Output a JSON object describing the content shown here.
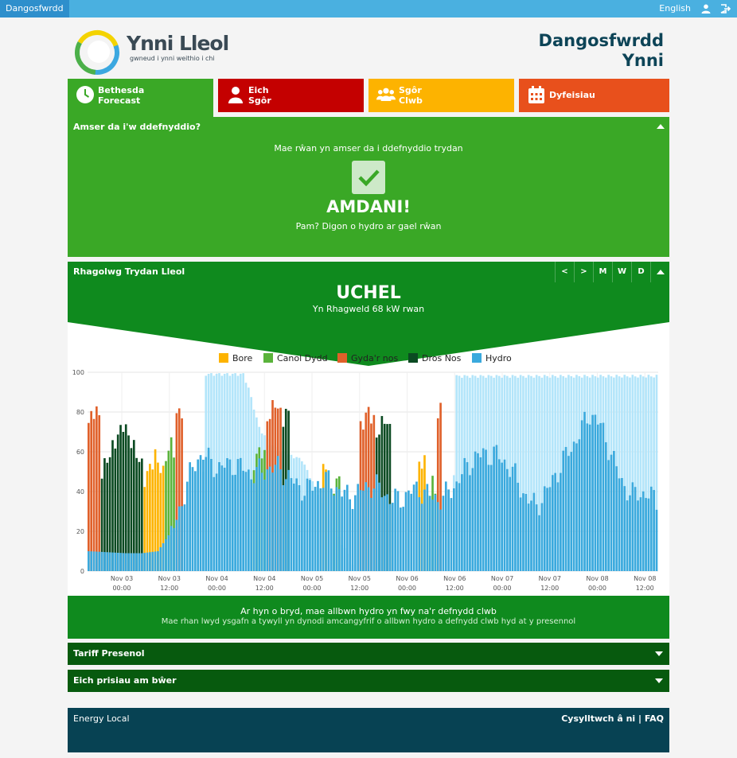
{
  "topbar": {
    "brand": "Dangosfwrdd",
    "language": "English"
  },
  "header": {
    "logo_name": "Ynni Lleol",
    "logo_tagline": "gwneud i ynni weithio i chi",
    "title_line1": "Dangosfwrdd",
    "title_line2": "Ynni"
  },
  "tabs": [
    {
      "label": "Bethesda\nForecast",
      "icon": "clock-icon",
      "color": "#3aa826"
    },
    {
      "label": "Eich\nSgôr",
      "icon": "person-icon",
      "color": "#c40000"
    },
    {
      "label": "Sgôr\nClwb",
      "icon": "group-icon",
      "color": "#fdb300"
    },
    {
      "label": "Dyfeisiau",
      "icon": "calendar-icon",
      "color": "#e8501c"
    }
  ],
  "good_time": {
    "title": "Amser da i'w ddefnyddio?",
    "message": "Mae rŵan yn amser da i ddefnyddio trydan",
    "verdict": "AMDANI!",
    "reason": "Pam? Digon o hydro ar gael rŵan"
  },
  "forecast": {
    "title": "Rhagolwg Trydan Lleol",
    "buttons": [
      "<",
      ">",
      "M",
      "W",
      "D"
    ],
    "level": "UCHEL",
    "subtitle": "Yn Rhagweld 68 kW rwan"
  },
  "chart_data": {
    "type": "bar",
    "ylim": [
      0,
      100
    ],
    "yticks": [
      0,
      20,
      40,
      60,
      80,
      100
    ],
    "grid": true,
    "legend_position": "top",
    "xticks": [
      "Nov 03\n00:00",
      "Nov 03\n12:00",
      "Nov 04\n00:00",
      "Nov 04\n12:00",
      "Nov 05\n00:00",
      "Nov 05\n12:00",
      "Nov 06\n00:00",
      "Nov 06\n12:00",
      "Nov 07\n00:00",
      "Nov 07\n12:00",
      "Nov 08\n00:00",
      "Nov 08\n12:00"
    ],
    "series": [
      {
        "name": "Bore",
        "color": "#fdb300"
      },
      {
        "name": "Canol Dydd",
        "color": "#5ab33b"
      },
      {
        "name": "Gyda'r nos",
        "color": "#e0602a"
      },
      {
        "name": "Dros Nos",
        "color": "#0b4a22"
      },
      {
        "name": "Hydro",
        "color": "#3aa9dd"
      }
    ],
    "forecast_color": "#b3e5fa",
    "hydro_profile": [
      [
        0,
        10
      ],
      [
        14,
        9
      ],
      [
        20,
        9
      ],
      [
        26,
        10
      ],
      [
        30,
        18
      ],
      [
        34,
        30
      ],
      [
        38,
        45
      ],
      [
        41,
        55
      ],
      [
        43,
        60
      ],
      [
        45,
        58
      ],
      [
        48,
        55
      ],
      [
        52,
        52
      ],
      [
        56,
        50
      ],
      [
        60,
        50
      ],
      [
        64,
        53
      ],
      [
        68,
        52
      ],
      [
        70,
        50
      ],
      [
        74,
        46
      ],
      [
        78,
        45
      ],
      [
        82,
        44
      ],
      [
        86,
        43
      ],
      [
        90,
        42
      ],
      [
        94,
        41
      ],
      [
        98,
        41
      ],
      [
        102,
        40
      ],
      [
        106,
        40
      ],
      [
        110,
        40
      ],
      [
        114,
        39
      ],
      [
        118,
        38
      ],
      [
        122,
        38
      ],
      [
        126,
        38
      ],
      [
        130,
        39
      ],
      [
        134,
        40
      ],
      [
        138,
        42
      ],
      [
        142,
        50
      ],
      [
        145,
        58
      ],
      [
        148,
        62
      ],
      [
        152,
        60
      ],
      [
        156,
        52
      ],
      [
        160,
        46
      ],
      [
        164,
        40
      ],
      [
        168,
        35
      ],
      [
        172,
        38
      ],
      [
        176,
        48
      ],
      [
        180,
        62
      ],
      [
        184,
        72
      ],
      [
        188,
        78
      ],
      [
        192,
        70
      ],
      [
        196,
        60
      ],
      [
        200,
        48
      ],
      [
        204,
        38
      ],
      [
        208,
        36
      ],
      [
        213,
        36
      ]
    ],
    "forecast_profile": [
      [
        0,
        0
      ],
      [
        42,
        0
      ],
      [
        44,
        99
      ],
      [
        58,
        99
      ],
      [
        60,
        92
      ],
      [
        64,
        72
      ],
      [
        68,
        64
      ],
      [
        72,
        60
      ],
      [
        76,
        58
      ],
      [
        80,
        56
      ],
      [
        100,
        0
      ],
      [
        136,
        0
      ],
      [
        138,
        98
      ],
      [
        213,
        98
      ]
    ],
    "usage_periods": [
      {
        "series": "Gyda'r nos",
        "from": 0,
        "to": 5,
        "peak": 82
      },
      {
        "series": "Dros Nos",
        "from": 5,
        "to": 21,
        "peak": 74
      },
      {
        "series": "Bore",
        "from": 21,
        "to": 29,
        "peak": 58
      },
      {
        "series": "Canol Dydd",
        "from": 29,
        "to": 33,
        "peak": 64
      },
      {
        "series": "Gyda'r nos",
        "from": 33,
        "to": 36,
        "peak": 82
      },
      {
        "series": "Canol Dydd",
        "from": 62,
        "to": 67,
        "peak": 62
      },
      {
        "series": "Gyda'r nos",
        "from": 67,
        "to": 73,
        "peak": 85
      },
      {
        "series": "Dros Nos",
        "from": 73,
        "to": 76,
        "peak": 81
      },
      {
        "series": "Bore",
        "from": 88,
        "to": 90,
        "peak": 53
      },
      {
        "series": "Canol Dydd",
        "from": 92,
        "to": 95,
        "peak": 47
      },
      {
        "series": "Gyda'r nos",
        "from": 102,
        "to": 108,
        "peak": 81
      },
      {
        "series": "Dros Nos",
        "from": 108,
        "to": 114,
        "peak": 77
      },
      {
        "series": "Bore",
        "from": 124,
        "to": 127,
        "peak": 57
      },
      {
        "series": "Canol Dydd",
        "from": 127,
        "to": 131,
        "peak": 44
      },
      {
        "series": "Gyda'r nos",
        "from": 131,
        "to": 133,
        "peak": 81
      }
    ]
  },
  "info": {
    "line1": "Ar hyn o bryd, mae allbwn hydro yn fwy na'r defnydd clwb",
    "line2": "Mae rhan lwyd ysgafn a tywyll yn dynodi amcangyfrif o allbwn hydro a defnydd clwb hyd at y presennol"
  },
  "sections": {
    "tariff": "Tariff Presenol",
    "prices": "Eich prisiau am bŵer"
  },
  "footer": {
    "left": "Energy Local",
    "right": "Cysylltwch â ni | FAQ"
  }
}
